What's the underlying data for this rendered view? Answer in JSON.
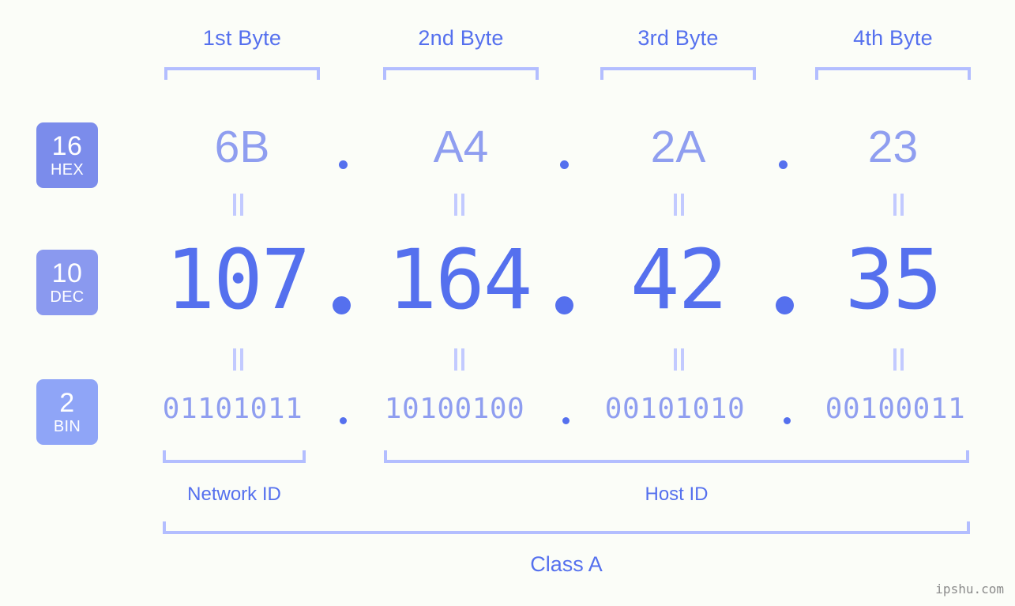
{
  "background_color": "#fbfdf8",
  "accent_color": "#5570ee",
  "muted_accent_color": "#8f9ef0",
  "bracket_color": "#b3beff",
  "byte_headers": [
    {
      "label": "1st Byte"
    },
    {
      "label": "2nd Byte"
    },
    {
      "label": "3rd Byte"
    },
    {
      "label": "4th Byte"
    }
  ],
  "bases": [
    {
      "num": "16",
      "abbr": "HEX",
      "color": "#7b8ceb"
    },
    {
      "num": "10",
      "abbr": "DEC",
      "color": "#8a99ef"
    },
    {
      "num": "2",
      "abbr": "BIN",
      "color": "#8fa5f7"
    }
  ],
  "rows": {
    "hex": {
      "values": [
        "6B",
        "A4",
        "2A",
        "23"
      ]
    },
    "dec": {
      "values": [
        "107",
        "164",
        "42",
        "35"
      ]
    },
    "bin": {
      "values": [
        "01101011",
        "10100100",
        "00101010",
        "00100011"
      ]
    }
  },
  "separator": ".",
  "equals_symbol": "=",
  "segments": [
    {
      "label": "Network ID"
    },
    {
      "label": "Host ID"
    }
  ],
  "class": {
    "label": "Class A"
  },
  "watermark": {
    "text": "ipshu.com"
  }
}
